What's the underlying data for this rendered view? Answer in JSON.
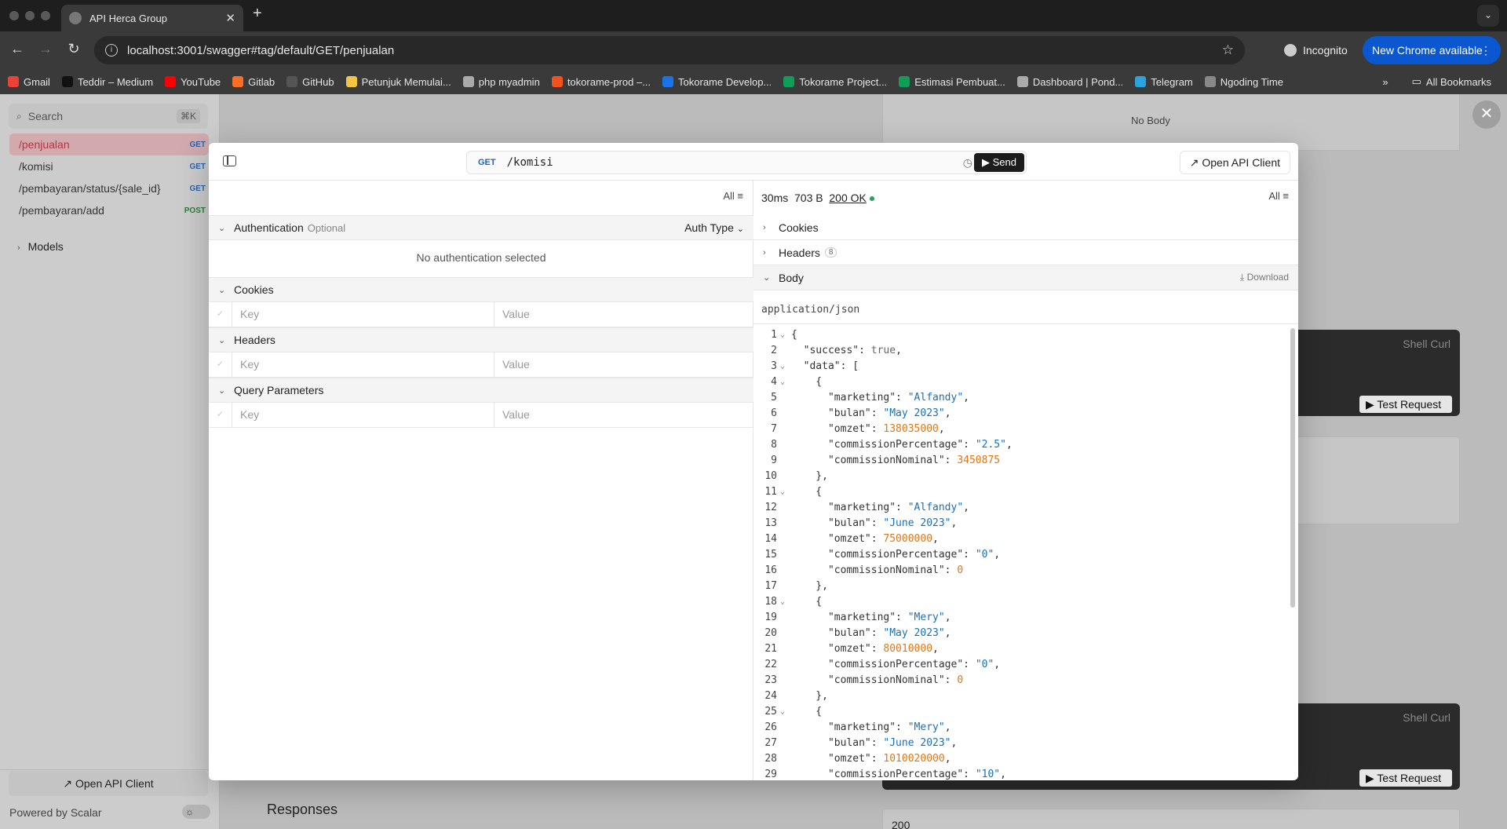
{
  "browser": {
    "tab_title": "API Herca Group",
    "url": "localhost:3001/swagger#tag/default/GET/penjualan",
    "incognito_label": "Incognito",
    "update_label": "New Chrome available",
    "bookmarks": [
      {
        "label": "Gmail",
        "color": "#ea4335"
      },
      {
        "label": "Teddir – Medium",
        "color": "#111111"
      },
      {
        "label": "YouTube",
        "color": "#ff0000"
      },
      {
        "label": "Gitlab",
        "color": "#fc6d26"
      },
      {
        "label": "GitHub",
        "color": "#555555"
      },
      {
        "label": "Petunjuk Memulai...",
        "color": "#f4c542"
      },
      {
        "label": "php myadmin",
        "color": "#aaaaaa"
      },
      {
        "label": "tokorame-prod –...",
        "color": "#f4511e"
      },
      {
        "label": "Tokorame Develop...",
        "color": "#1a73e8"
      },
      {
        "label": "Tokorame Project...",
        "color": "#0f9d58"
      },
      {
        "label": "Estimasi Pembuat...",
        "color": "#0f9d58"
      },
      {
        "label": "Dashboard | Pond...",
        "color": "#aaaaaa"
      },
      {
        "label": "Telegram",
        "color": "#2aa3df"
      },
      {
        "label": "Ngoding Time",
        "color": "#888888"
      }
    ],
    "all_bookmarks_label": "All Bookmarks"
  },
  "sidebar": {
    "search_placeholder": "Search",
    "search_shortcut": "⌘K",
    "items": [
      {
        "path": "/penjualan",
        "method": "GET"
      },
      {
        "path": "/komisi",
        "method": "GET"
      },
      {
        "path": "/pembayaran/status/{sale_id}",
        "method": "GET"
      },
      {
        "path": "/pembayaran/add",
        "method": "POST"
      }
    ],
    "models_label": "Models",
    "open_client_label": "Open API Client",
    "powered_by": "Powered by Scalar"
  },
  "background": {
    "no_body": "No Body",
    "shell_curl": "Shell Curl",
    "test_request": "Test Request",
    "responses_heading": "Responses",
    "status_code": "200"
  },
  "modal": {
    "method": "GET",
    "path": "/komisi",
    "send_label": "Send",
    "open_client_label": "Open API Client",
    "left_filter": "All",
    "auth_title": "Authentication",
    "auth_optional": "Optional",
    "auth_type_label": "Auth Type",
    "no_auth_text": "No authentication selected",
    "cookies_title": "Cookies",
    "headers_title": "Headers",
    "query_title": "Query Parameters",
    "key_placeholder": "Key",
    "value_placeholder": "Value",
    "response": {
      "time": "30ms",
      "size": "703 B",
      "status": "200 OK",
      "filter": "All",
      "cookies_label": "Cookies",
      "headers_label": "Headers",
      "headers_count": "8",
      "body_label": "Body",
      "download_label": "Download",
      "content_type": "application/json"
    }
  },
  "json_lines": [
    {
      "n": "1",
      "f": true,
      "t": "{"
    },
    {
      "n": "2",
      "f": false,
      "t": "  \"success\": true,"
    },
    {
      "n": "3",
      "f": true,
      "t": "  \"data\": ["
    },
    {
      "n": "4",
      "f": true,
      "t": "    {"
    },
    {
      "n": "5",
      "f": false,
      "t": "      \"marketing\": \"Alfandy\","
    },
    {
      "n": "6",
      "f": false,
      "t": "      \"bulan\": \"May 2023\","
    },
    {
      "n": "7",
      "f": false,
      "t": "      \"omzet\": 138035000,"
    },
    {
      "n": "8",
      "f": false,
      "t": "      \"commissionPercentage\": \"2.5\","
    },
    {
      "n": "9",
      "f": false,
      "t": "      \"commissionNominal\": 3450875"
    },
    {
      "n": "10",
      "f": false,
      "t": "    },"
    },
    {
      "n": "11",
      "f": true,
      "t": "    {"
    },
    {
      "n": "12",
      "f": false,
      "t": "      \"marketing\": \"Alfandy\","
    },
    {
      "n": "13",
      "f": false,
      "t": "      \"bulan\": \"June 2023\","
    },
    {
      "n": "14",
      "f": false,
      "t": "      \"omzet\": 75000000,"
    },
    {
      "n": "15",
      "f": false,
      "t": "      \"commissionPercentage\": \"0\","
    },
    {
      "n": "16",
      "f": false,
      "t": "      \"commissionNominal\": 0"
    },
    {
      "n": "17",
      "f": false,
      "t": "    },"
    },
    {
      "n": "18",
      "f": true,
      "t": "    {"
    },
    {
      "n": "19",
      "f": false,
      "t": "      \"marketing\": \"Mery\","
    },
    {
      "n": "20",
      "f": false,
      "t": "      \"bulan\": \"May 2023\","
    },
    {
      "n": "21",
      "f": false,
      "t": "      \"omzet\": 80010000,"
    },
    {
      "n": "22",
      "f": false,
      "t": "      \"commissionPercentage\": \"0\","
    },
    {
      "n": "23",
      "f": false,
      "t": "      \"commissionNominal\": 0"
    },
    {
      "n": "24",
      "f": false,
      "t": "    },"
    },
    {
      "n": "25",
      "f": true,
      "t": "    {"
    },
    {
      "n": "26",
      "f": false,
      "t": "      \"marketing\": \"Mery\","
    },
    {
      "n": "27",
      "f": false,
      "t": "      \"bulan\": \"June 2023\","
    },
    {
      "n": "28",
      "f": false,
      "t": "      \"omzet\": 1010020000,"
    },
    {
      "n": "29",
      "f": false,
      "t": "      \"commissionPercentage\": \"10\","
    }
  ]
}
